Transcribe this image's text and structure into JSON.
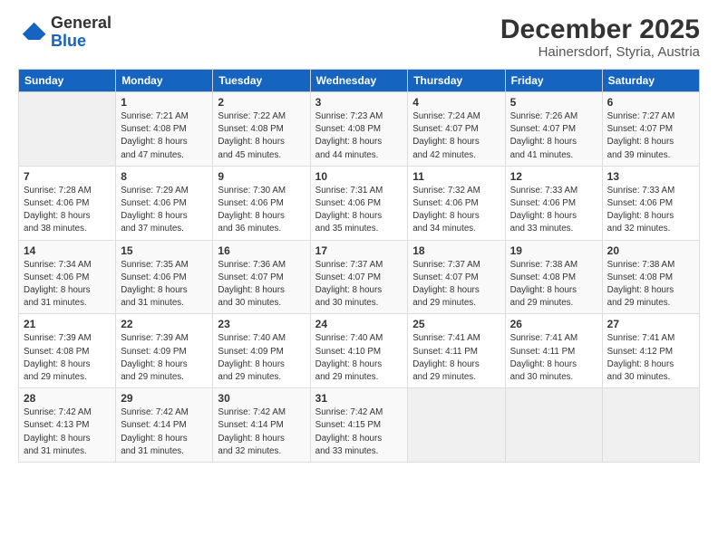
{
  "logo": {
    "general": "General",
    "blue": "Blue"
  },
  "header": {
    "month": "December 2025",
    "location": "Hainersdorf, Styria, Austria"
  },
  "weekdays": [
    "Sunday",
    "Monday",
    "Tuesday",
    "Wednesday",
    "Thursday",
    "Friday",
    "Saturday"
  ],
  "weeks": [
    [
      {
        "day": null,
        "info": null
      },
      {
        "day": "1",
        "info": "Sunrise: 7:21 AM\nSunset: 4:08 PM\nDaylight: 8 hours\nand 47 minutes."
      },
      {
        "day": "2",
        "info": "Sunrise: 7:22 AM\nSunset: 4:08 PM\nDaylight: 8 hours\nand 45 minutes."
      },
      {
        "day": "3",
        "info": "Sunrise: 7:23 AM\nSunset: 4:08 PM\nDaylight: 8 hours\nand 44 minutes."
      },
      {
        "day": "4",
        "info": "Sunrise: 7:24 AM\nSunset: 4:07 PM\nDaylight: 8 hours\nand 42 minutes."
      },
      {
        "day": "5",
        "info": "Sunrise: 7:26 AM\nSunset: 4:07 PM\nDaylight: 8 hours\nand 41 minutes."
      },
      {
        "day": "6",
        "info": "Sunrise: 7:27 AM\nSunset: 4:07 PM\nDaylight: 8 hours\nand 39 minutes."
      }
    ],
    [
      {
        "day": "7",
        "info": "Sunrise: 7:28 AM\nSunset: 4:06 PM\nDaylight: 8 hours\nand 38 minutes."
      },
      {
        "day": "8",
        "info": "Sunrise: 7:29 AM\nSunset: 4:06 PM\nDaylight: 8 hours\nand 37 minutes."
      },
      {
        "day": "9",
        "info": "Sunrise: 7:30 AM\nSunset: 4:06 PM\nDaylight: 8 hours\nand 36 minutes."
      },
      {
        "day": "10",
        "info": "Sunrise: 7:31 AM\nSunset: 4:06 PM\nDaylight: 8 hours\nand 35 minutes."
      },
      {
        "day": "11",
        "info": "Sunrise: 7:32 AM\nSunset: 4:06 PM\nDaylight: 8 hours\nand 34 minutes."
      },
      {
        "day": "12",
        "info": "Sunrise: 7:33 AM\nSunset: 4:06 PM\nDaylight: 8 hours\nand 33 minutes."
      },
      {
        "day": "13",
        "info": "Sunrise: 7:33 AM\nSunset: 4:06 PM\nDaylight: 8 hours\nand 32 minutes."
      }
    ],
    [
      {
        "day": "14",
        "info": "Sunrise: 7:34 AM\nSunset: 4:06 PM\nDaylight: 8 hours\nand 31 minutes."
      },
      {
        "day": "15",
        "info": "Sunrise: 7:35 AM\nSunset: 4:06 PM\nDaylight: 8 hours\nand 31 minutes."
      },
      {
        "day": "16",
        "info": "Sunrise: 7:36 AM\nSunset: 4:07 PM\nDaylight: 8 hours\nand 30 minutes."
      },
      {
        "day": "17",
        "info": "Sunrise: 7:37 AM\nSunset: 4:07 PM\nDaylight: 8 hours\nand 30 minutes."
      },
      {
        "day": "18",
        "info": "Sunrise: 7:37 AM\nSunset: 4:07 PM\nDaylight: 8 hours\nand 29 minutes."
      },
      {
        "day": "19",
        "info": "Sunrise: 7:38 AM\nSunset: 4:08 PM\nDaylight: 8 hours\nand 29 minutes."
      },
      {
        "day": "20",
        "info": "Sunrise: 7:38 AM\nSunset: 4:08 PM\nDaylight: 8 hours\nand 29 minutes."
      }
    ],
    [
      {
        "day": "21",
        "info": "Sunrise: 7:39 AM\nSunset: 4:08 PM\nDaylight: 8 hours\nand 29 minutes."
      },
      {
        "day": "22",
        "info": "Sunrise: 7:39 AM\nSunset: 4:09 PM\nDaylight: 8 hours\nand 29 minutes."
      },
      {
        "day": "23",
        "info": "Sunrise: 7:40 AM\nSunset: 4:09 PM\nDaylight: 8 hours\nand 29 minutes."
      },
      {
        "day": "24",
        "info": "Sunrise: 7:40 AM\nSunset: 4:10 PM\nDaylight: 8 hours\nand 29 minutes."
      },
      {
        "day": "25",
        "info": "Sunrise: 7:41 AM\nSunset: 4:11 PM\nDaylight: 8 hours\nand 29 minutes."
      },
      {
        "day": "26",
        "info": "Sunrise: 7:41 AM\nSunset: 4:11 PM\nDaylight: 8 hours\nand 30 minutes."
      },
      {
        "day": "27",
        "info": "Sunrise: 7:41 AM\nSunset: 4:12 PM\nDaylight: 8 hours\nand 30 minutes."
      }
    ],
    [
      {
        "day": "28",
        "info": "Sunrise: 7:42 AM\nSunset: 4:13 PM\nDaylight: 8 hours\nand 31 minutes."
      },
      {
        "day": "29",
        "info": "Sunrise: 7:42 AM\nSunset: 4:14 PM\nDaylight: 8 hours\nand 31 minutes."
      },
      {
        "day": "30",
        "info": "Sunrise: 7:42 AM\nSunset: 4:14 PM\nDaylight: 8 hours\nand 32 minutes."
      },
      {
        "day": "31",
        "info": "Sunrise: 7:42 AM\nSunset: 4:15 PM\nDaylight: 8 hours\nand 33 minutes."
      },
      {
        "day": null,
        "info": null
      },
      {
        "day": null,
        "info": null
      },
      {
        "day": null,
        "info": null
      }
    ]
  ]
}
